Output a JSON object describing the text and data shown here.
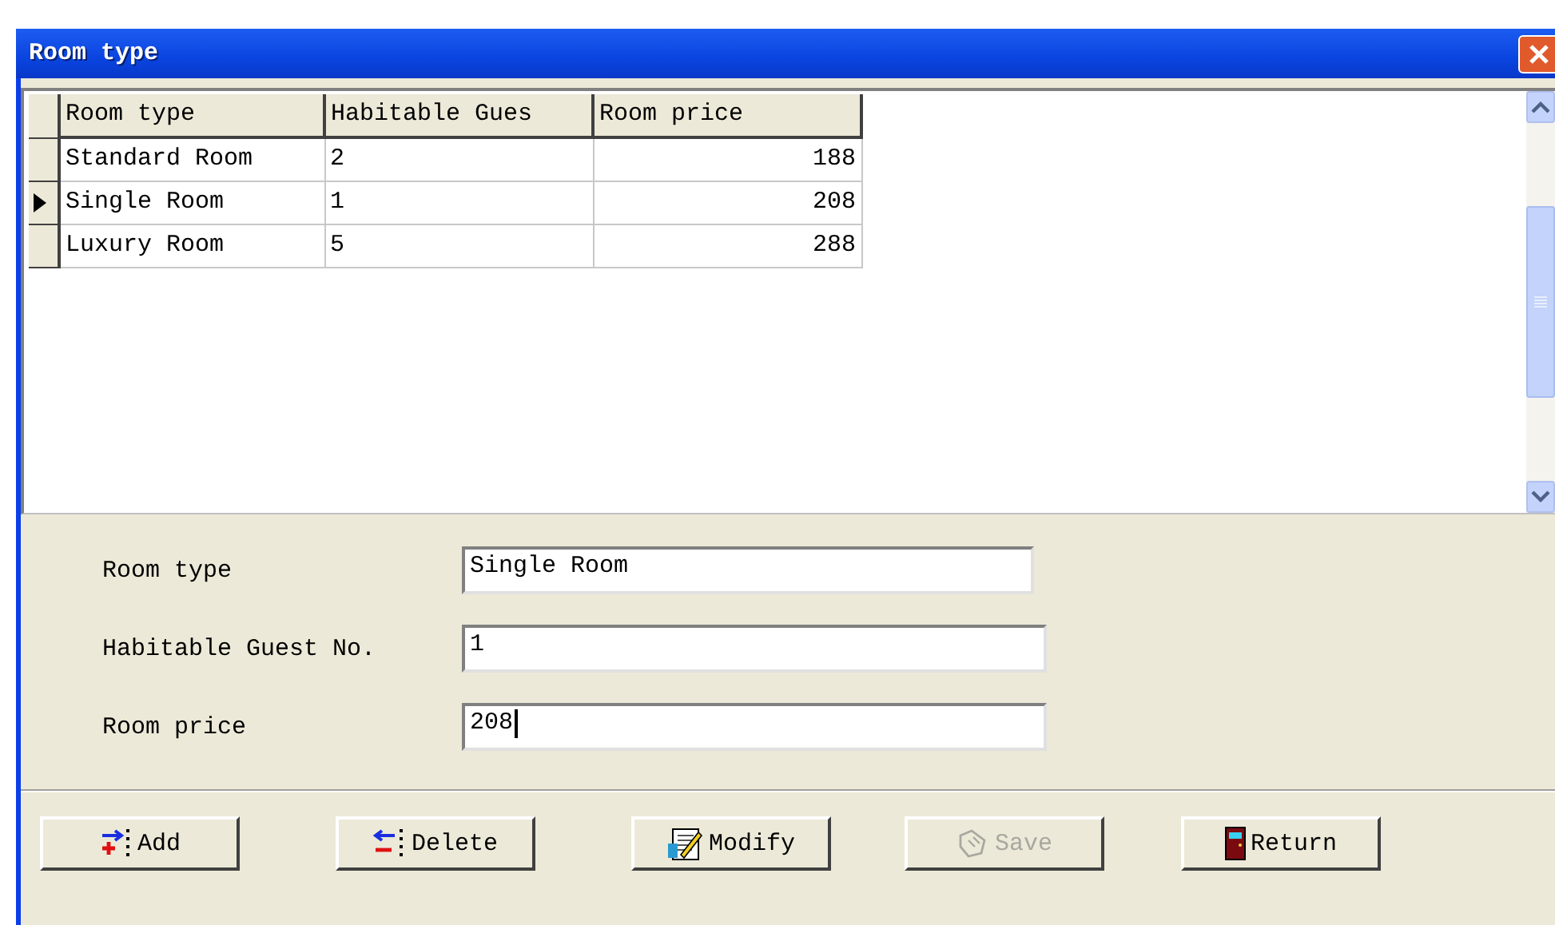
{
  "window": {
    "title": "Room type"
  },
  "table": {
    "columns": [
      "Room type",
      "Habitable Gues",
      "Room price"
    ],
    "rows": [
      {
        "cells": [
          "Standard Room",
          "2",
          "188"
        ],
        "selected": false
      },
      {
        "cells": [
          "Single Room",
          "1",
          "208"
        ],
        "selected": true
      },
      {
        "cells": [
          "Luxury Room",
          "5",
          "288"
        ],
        "selected": false
      }
    ]
  },
  "form": [
    {
      "label": "Room type",
      "value": "Single Room",
      "focused": false
    },
    {
      "label": "Habitable Guest No.",
      "value": "1",
      "focused": false
    },
    {
      "label": "Room price",
      "value": "208",
      "focused": true
    }
  ],
  "buttons": [
    {
      "label": "Add",
      "kind": "add",
      "disabled": false
    },
    {
      "label": "Delete",
      "kind": "delete",
      "disabled": false
    },
    {
      "label": "Modify",
      "kind": "modify",
      "disabled": false
    },
    {
      "label": "Save",
      "kind": "save",
      "disabled": true
    },
    {
      "label": "Return",
      "kind": "return",
      "disabled": false
    }
  ]
}
